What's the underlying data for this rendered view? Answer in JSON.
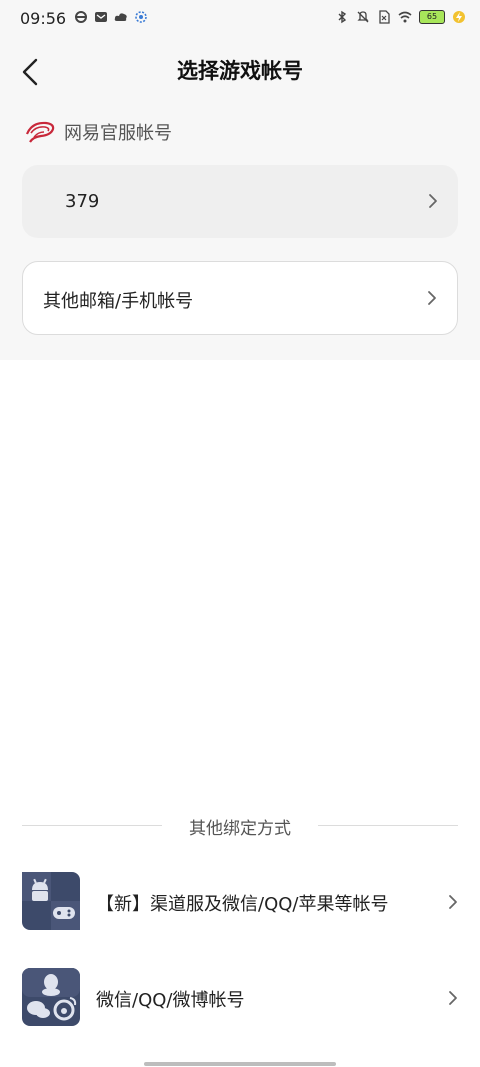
{
  "status_bar": {
    "time": "09:56",
    "battery": "65"
  },
  "header": {
    "title": "选择游戏帐号"
  },
  "section": {
    "label": "网易官服帐号"
  },
  "accounts": [
    {
      "id": "379"
    }
  ],
  "other_login": {
    "label": "其他邮箱/手机帐号"
  },
  "divider": {
    "label": "其他绑定方式"
  },
  "bind_options": [
    {
      "label": "【新】渠道服及微信/QQ/苹果等帐号"
    },
    {
      "label": "微信/QQ/微博帐号"
    }
  ],
  "colors": {
    "accent": "#c8283a",
    "icon_bg": "#3d4a6a"
  }
}
